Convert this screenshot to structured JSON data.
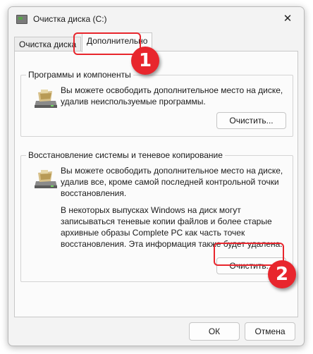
{
  "window": {
    "title": "Очистка диска  (C:)",
    "close_icon": "close-icon"
  },
  "tabs": [
    {
      "label": "Очистка диска",
      "active": false
    },
    {
      "label": "Дополнительно",
      "active": true
    }
  ],
  "sections": [
    {
      "title": "Программы и компоненты",
      "icon": "drive-cleanup-icon",
      "paragraphs": [
        "Вы можете освободить дополнительное место на диске, удалив неиспользуемые программы."
      ],
      "button_label": "Очистить..."
    },
    {
      "title": "Восстановление системы и теневое копирование",
      "icon": "drive-cleanup-icon",
      "paragraphs": [
        "Вы можете освободить дополнительное место на диске, удалив все, кроме самой последней контрольной точки восстановления.",
        "В некоторых выпусках Windows на диск могут записываться теневые копии файлов и более старые архивные образы Complete PC как часть точек восстановления. Эта информация также будет удалена."
      ],
      "button_label": "Очистить..."
    }
  ],
  "footer": {
    "ok_label": "ОК",
    "cancel_label": "Отмена"
  },
  "annotations": [
    {
      "number": "1"
    },
    {
      "number": "2"
    }
  ],
  "colors": {
    "highlight": "#e8262d",
    "window_bg": "#f3f3f3",
    "panel_bg": "#fbfbfb"
  }
}
